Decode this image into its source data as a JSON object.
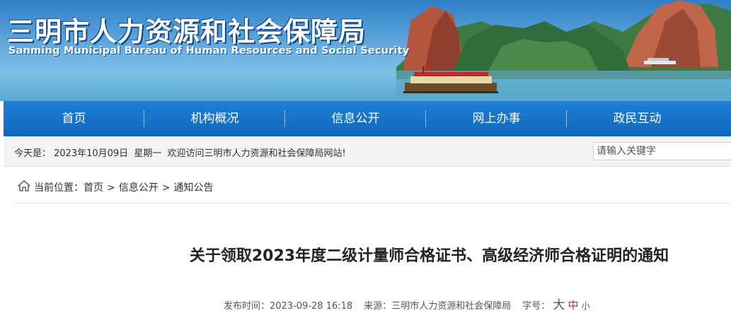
{
  "banner": {
    "title_cn": "三明市人力资源和社会保障局",
    "title_en": "Sanming Municipal Bureau of Human Resources and Social Security"
  },
  "nav": {
    "items": [
      {
        "label": "首页"
      },
      {
        "label": "机构概况"
      },
      {
        "label": "信息公开"
      },
      {
        "label": "网上办事"
      },
      {
        "label": "政民互动"
      }
    ]
  },
  "infobar": {
    "today_label": "今天是：",
    "date": "2023年10月09日",
    "weekday": "星期一",
    "welcome": "欢迎访问三明市人力资源和社会保障局网站!"
  },
  "search": {
    "placeholder": "请输入关键字"
  },
  "breadcrumb": {
    "label": "当前位置：",
    "items": [
      "首页",
      "信息公开",
      "通知公告"
    ],
    "separator": ">"
  },
  "article": {
    "title": "关于领取2023年度二级计量师合格证书、高级经济师合格证明的通知",
    "publish_label": "发布时间：",
    "publish_time": "2023-09-28 16:18",
    "source_label": "来源：",
    "source": "三明市人力资源和社会保障局",
    "font_size_label": "字号：",
    "font_sizes": [
      "大",
      "中",
      "小"
    ]
  },
  "colors": {
    "nav_bg": "#0d67bd",
    "infobar_bg": "#f3f3f3",
    "active_font_size": "#dd2222"
  }
}
